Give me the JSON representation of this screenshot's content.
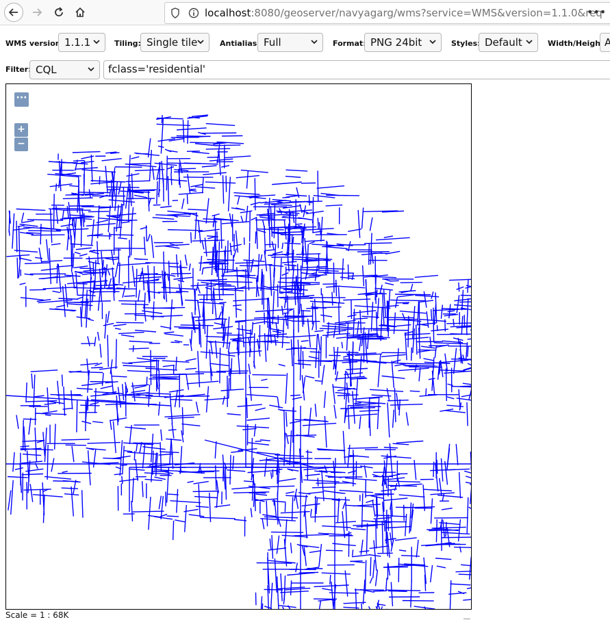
{
  "browser": {
    "url_host": "localhost",
    "url_rest": ":8080/geoserver/navyagarg/wms?service=WMS&version=1.1.0&req",
    "icons": [
      "back-arrow-icon",
      "forward-arrow-icon",
      "reload-icon",
      "home-icon",
      "shield-icon",
      "info-icon",
      "more-icon"
    ]
  },
  "toolbar": {
    "wms_version_label": "WMS version:",
    "wms_version_value": "1.1.1",
    "tiling_label": "Tiling:",
    "tiling_value": "Single tile",
    "antialias_label": "Antialias:",
    "antialias_value": "Full",
    "format_label": "Format:",
    "format_value": "PNG 24bit",
    "styles_label": "Styles:",
    "styles_value": "Default",
    "widthheight_label": "Width/Height:",
    "widthheight_value": "A"
  },
  "filter": {
    "label": "Filter:",
    "type_value": "CQL",
    "expression": "fclass='residential'"
  },
  "map": {
    "menu_label": "···",
    "zoom_in": "+",
    "zoom_out": "−",
    "road_color": "#0000ff"
  },
  "scale_text": "Scale = 1 : 68K"
}
